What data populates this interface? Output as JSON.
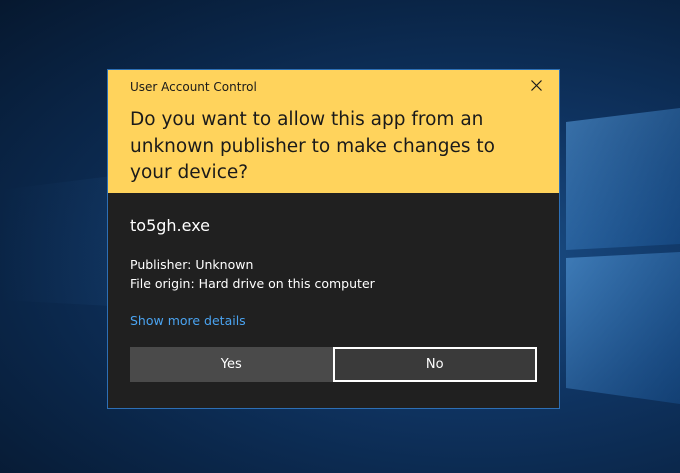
{
  "dialog": {
    "title": "User Account Control",
    "question": "Do you want to allow this app from an unknown publisher to make changes to your device?",
    "close_icon": "close-icon",
    "header_color": "#ffd35c",
    "body_color": "#202020"
  },
  "app": {
    "name": "to5gh.exe",
    "publisher": "Publisher: Unknown",
    "file_origin": "File origin: Hard drive on this computer"
  },
  "details_link": "Show more details",
  "buttons": {
    "yes": "Yes",
    "no": "No"
  },
  "colors": {
    "link": "#4aa3f0",
    "focus_border": "#ffffff"
  }
}
